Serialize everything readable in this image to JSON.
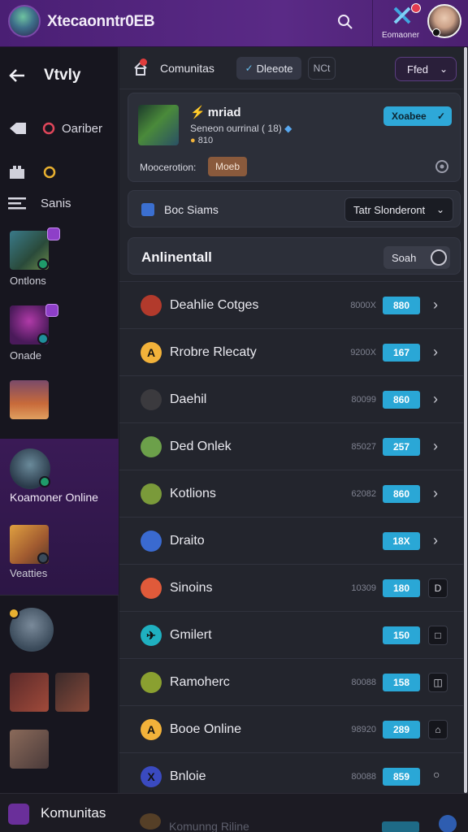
{
  "header": {
    "title": "Xtecaonntr0EB",
    "profile_label": "Eomaoner"
  },
  "sidebar": {
    "back_label": "Vtvly",
    "items": [
      {
        "label": "Oariber"
      },
      {
        "label": ""
      },
      {
        "label": "Sanis"
      }
    ],
    "tiles": [
      {
        "caption": "Ontlons"
      },
      {
        "caption": "Onade"
      },
      {
        "caption": ""
      },
      {
        "caption": "Koamoner Online"
      },
      {
        "caption": "Veatties"
      }
    ]
  },
  "toolbar": {
    "label": "Comunitas",
    "pill_label": "Dleeote",
    "ghost_label": "NCt",
    "select_label": "Ffed"
  },
  "feature": {
    "title": "mriad",
    "subtitle": "Seneon ourrinal ( 18)",
    "meta": "810",
    "button_label": "Xoabee",
    "mod_label": "Moocerotion:",
    "tag_label": "Moeb"
  },
  "filter": {
    "label": "Boc Siams",
    "select_label": "Tatr Slonderont"
  },
  "section": {
    "title": "Anlinentall",
    "toggle_label": "Soah"
  },
  "list": [
    {
      "name": "Deahlie Cotges",
      "stat": "8000X",
      "badge": "880",
      "end": "chevron",
      "icon_color": "#b23a2c",
      "icon_glyph": ""
    },
    {
      "name": "Rrobre Rlecaty",
      "stat": "9200X",
      "badge": "167",
      "end": "chevron",
      "icon_color": "#f2b23a",
      "icon_glyph": "A"
    },
    {
      "name": "Daehil",
      "stat": "80099",
      "badge": "860",
      "end": "chevron",
      "icon_color": "#3b3a3e",
      "icon_glyph": ""
    },
    {
      "name": "Ded Onlek",
      "stat": "85027",
      "badge": "257",
      "end": "chevron",
      "icon_color": "#6ca04a",
      "icon_glyph": ""
    },
    {
      "name": "Kotlions",
      "stat": "62082",
      "badge": "860",
      "end": "chevron",
      "icon_color": "#7a9a3a",
      "icon_glyph": ""
    },
    {
      "name": "Draito",
      "stat": "",
      "badge": "18X",
      "end": "chevron",
      "icon_color": "#3a6ad0",
      "icon_glyph": ""
    },
    {
      "name": "Sinoins",
      "stat": "10309",
      "badge": "180",
      "end": "box",
      "box_glyph": "D",
      "icon_color": "#e05a3a",
      "icon_glyph": ""
    },
    {
      "name": "Gmilert",
      "stat": "",
      "badge": "150",
      "end": "box",
      "box_glyph": "□",
      "icon_color": "#1fb0c0",
      "icon_glyph": "✈"
    },
    {
      "name": "Ramoherc",
      "stat": "80088",
      "badge": "158",
      "end": "box",
      "box_glyph": "◫",
      "icon_color": "#8aa030",
      "icon_glyph": ""
    },
    {
      "name": "Booe Online",
      "stat": "98920",
      "badge": "289",
      "end": "box",
      "box_glyph": "⌂",
      "icon_color": "#f2b23a",
      "icon_glyph": "A"
    },
    {
      "name": "Bnloie",
      "stat": "80088",
      "badge": "859",
      "end": "circle",
      "icon_color": "#3a4ac0",
      "icon_glyph": "X"
    }
  ],
  "bottombar": {
    "label": "Komunitas",
    "ghost_text": "Komunng Riline"
  },
  "colors": {
    "accent_purple": "#5a2a86",
    "badge_blue": "#2aa7d6",
    "panel": "#23252d"
  }
}
